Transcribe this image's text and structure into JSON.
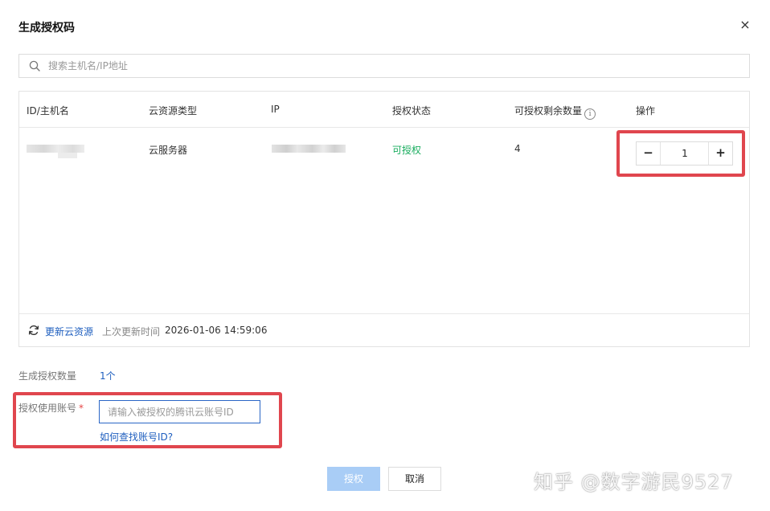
{
  "dialog": {
    "title": "生成授权码",
    "close_symbol": "×"
  },
  "search": {
    "placeholder": "搜索主机名/IP地址",
    "value": "",
    "icon": "search-icon"
  },
  "table": {
    "columns": [
      "ID/主机名",
      "云资源类型",
      "IP",
      "授权状态",
      "可授权剩余数量",
      "操作"
    ],
    "info_symbol": "i",
    "rows": [
      {
        "id_hostname": "",
        "resource_type": "云服务器",
        "ip": "",
        "status": "可授权",
        "remaining": "4",
        "quantity": "1"
      }
    ],
    "stepper": {
      "minus": "−",
      "plus": "+"
    },
    "status_color": "#1aad5f"
  },
  "footer": {
    "refresh_label": "更新云资源",
    "last_update_label": "上次更新时间",
    "last_update_value": "2026-01-06 14:59:06"
  },
  "form": {
    "count_label": "生成授权数量",
    "count_value": "1个",
    "account_label": "授权使用账号",
    "required_mark": "*",
    "account_placeholder": "请输入被授权的腾讯云账号ID",
    "account_value": "",
    "help_link": "如何查找账号ID?"
  },
  "actions": {
    "authorize": "授权",
    "cancel": "取消"
  },
  "watermark": "知乎 @数字游民9527",
  "colors": {
    "link": "#1f5fbf",
    "highlight": "#e0464e",
    "primary_disabled": "#a9cdf6"
  }
}
